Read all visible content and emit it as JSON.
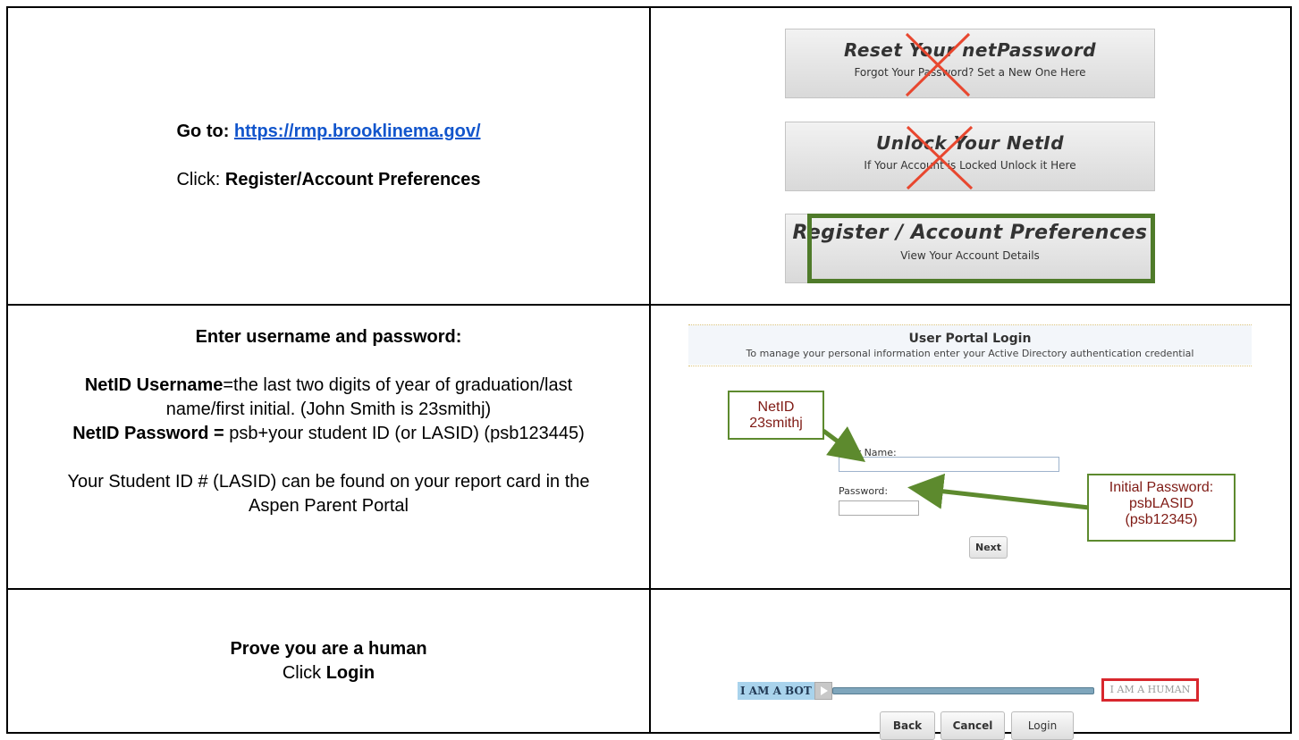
{
  "row1": {
    "go_prefix": "Go to: ",
    "url": "https://rmp.brooklinema.gov/",
    "click_prefix": "Click: ",
    "click_target": "Register/Account Preferences",
    "buttons": [
      {
        "title": "Reset Your netPassword",
        "subtitle": "Forgot Your Password? Set a New One Here",
        "crossed": true
      },
      {
        "title": "Unlock Your NetId",
        "subtitle": "If Your Account is Locked Unlock it Here",
        "crossed": true
      },
      {
        "title": "Register / Account Preferences",
        "subtitle": "View Your Account Details",
        "crossed": false
      }
    ]
  },
  "row2": {
    "heading": "Enter username and password:",
    "username_label": "NetID Username",
    "username_desc": "=the last two digits of year of graduation/last name/first initial. (John Smith is 23smithj)",
    "password_label": "NetID Password =",
    "password_desc": " psb+your student ID (or LASID) (psb123445)",
    "note": "Your Student ID # (LASID) can be found on your report card in the Aspen Parent Portal",
    "portal": {
      "title": "User Portal Login",
      "subtitle": "To manage your personal information enter your Active Directory authentication credential",
      "user_label": "User Name:",
      "password_label": "Password:",
      "next_label": "Next"
    },
    "callout_user": {
      "line1": "NetID",
      "line2": "23smithj"
    },
    "callout_pass": {
      "line1": "Initial Password:",
      "line2": "psbLASID",
      "line3": "(psb12345)"
    }
  },
  "row3": {
    "heading": "Prove you are a human",
    "click_prefix": "Click ",
    "click_target": "Login",
    "slider": {
      "left_label": "I AM A BOT",
      "right_label": "I AM A HUMAN"
    },
    "buttons": {
      "back": "Back",
      "cancel": "Cancel",
      "login": "Login"
    }
  },
  "colors": {
    "link": "#1155cc",
    "highlight_box": "#4f7b2a",
    "cross": "#e8472f",
    "callout_text": "#7f1a14",
    "human_box": "#d8272d"
  }
}
